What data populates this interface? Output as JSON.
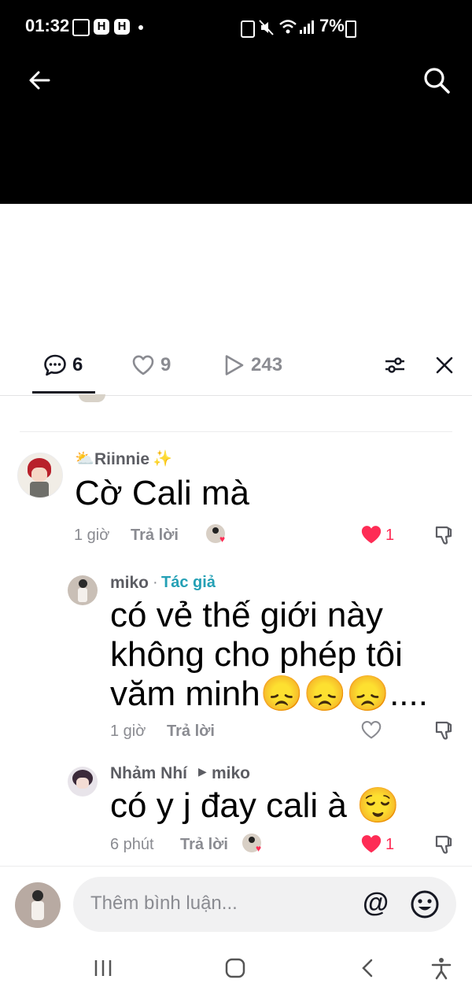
{
  "status_bar": {
    "time": "01:32",
    "battery": "7%"
  },
  "tabs": [
    {
      "icon": "comment-icon",
      "count": "6"
    },
    {
      "icon": "heart-icon",
      "count": "9"
    },
    {
      "icon": "play-icon",
      "count": "243"
    }
  ],
  "comments": [
    {
      "username": "Riinnie",
      "text": "Cờ Cali mà",
      "time": "1 giờ",
      "reply_label": "Trả lời",
      "likes": "1"
    },
    {
      "username": "miko",
      "author_badge": "Tác giả",
      "text": "có vẻ thế giới này không cho phép tôi văm minh😞😞😞....",
      "time": "1 giờ",
      "reply_label": "Trả lời"
    },
    {
      "username": "Nhảm Nhí",
      "reply_to": "miko",
      "text": "có y j đay cali à 😌",
      "time": "6 phút",
      "reply_label": "Trả lời",
      "likes": "1"
    }
  ],
  "input": {
    "placeholder": "Thêm bình luận..."
  },
  "colors": {
    "like_red": "#fe2c55",
    "author_teal": "#24a0b5"
  }
}
